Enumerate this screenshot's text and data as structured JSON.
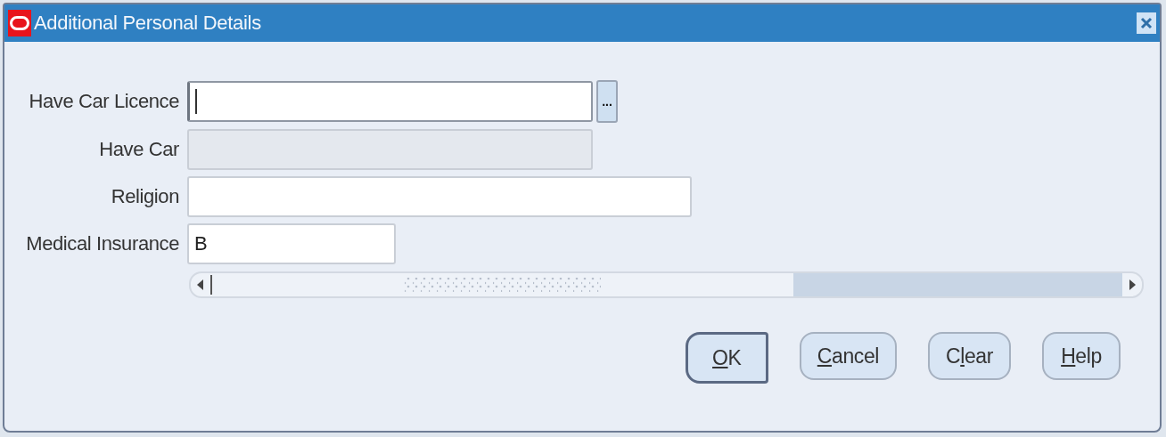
{
  "window": {
    "title": "Additional Personal Details"
  },
  "fields": [
    {
      "label": "Have Car Licence",
      "focused": true,
      "disabled": false,
      "lov": true
    },
    {
      "label": "Have Car",
      "focused": false,
      "disabled": true,
      "lov": false
    },
    {
      "label": "Religion",
      "focused": false,
      "disabled": false,
      "lov": false
    },
    {
      "label": "Medical Insurance",
      "value": "B",
      "focused": false,
      "disabled": false,
      "lov": false
    }
  ],
  "lov_button": {
    "label": "..."
  },
  "buttons": [
    {
      "key": "O",
      "after": "K",
      "default": true
    },
    {
      "key": "C",
      "after": "ancel",
      "default": false
    },
    {
      "before": "C",
      "key": "l",
      "after": "ear",
      "default": false
    },
    {
      "key": "H",
      "after": "elp",
      "default": false
    }
  ]
}
